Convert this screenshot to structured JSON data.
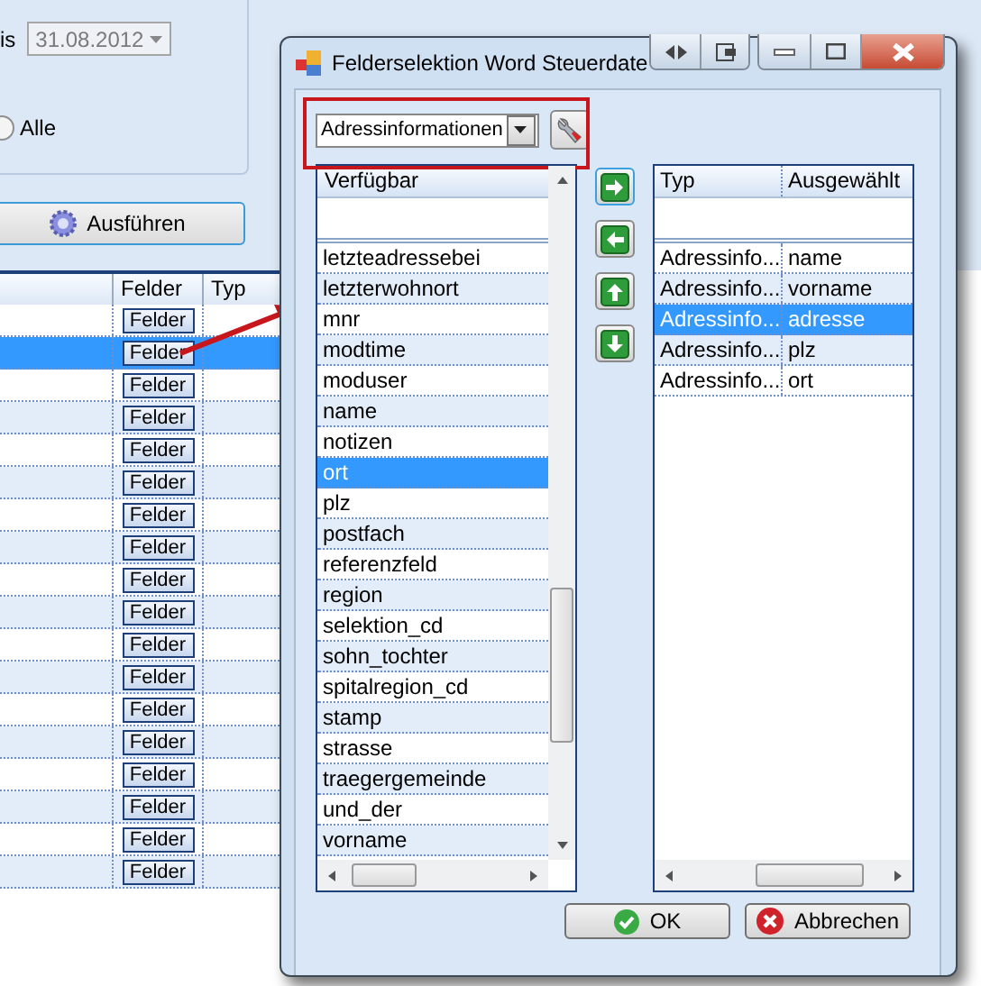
{
  "filter": {
    "date_label": "is",
    "date": "31.08.2012",
    "radio": {
      "label": "Alle",
      "selected": false
    }
  },
  "run_button": "Ausführen",
  "grid": {
    "columns": [
      "Felder",
      "Typ"
    ],
    "rows": [
      {
        "button": "Felder",
        "selected": false
      },
      {
        "button": "Felder",
        "selected": true
      },
      {
        "button": "Felder",
        "selected": false
      },
      {
        "button": "Felder",
        "selected": false
      },
      {
        "button": "Felder",
        "selected": false
      },
      {
        "button": "Felder",
        "selected": false
      },
      {
        "button": "Felder",
        "selected": false
      },
      {
        "button": "Felder",
        "selected": false
      },
      {
        "button": "Felder",
        "selected": false
      },
      {
        "button": "Felder",
        "selected": false
      },
      {
        "button": "Felder",
        "selected": false
      },
      {
        "button": "Felder",
        "selected": false
      },
      {
        "button": "Felder",
        "selected": false
      },
      {
        "button": "Felder",
        "selected": false
      },
      {
        "button": "Felder",
        "selected": false
      },
      {
        "button": "Felder",
        "selected": false
      },
      {
        "button": "Felder",
        "selected": false
      },
      {
        "button": "Felder",
        "selected": false
      }
    ]
  },
  "dialog": {
    "title": "Felderselektion Word Steuerdate",
    "category": "Adressinformationen",
    "available": {
      "header": "Verfügbar",
      "items": [
        {
          "label": "letzteadressebei",
          "selected": false
        },
        {
          "label": "letzterwohnort",
          "selected": false
        },
        {
          "label": "mnr",
          "selected": false
        },
        {
          "label": "modtime",
          "selected": false
        },
        {
          "label": "moduser",
          "selected": false
        },
        {
          "label": "name",
          "selected": false
        },
        {
          "label": "notizen",
          "selected": false
        },
        {
          "label": "ort",
          "selected": true
        },
        {
          "label": "plz",
          "selected": false
        },
        {
          "label": "postfach",
          "selected": false
        },
        {
          "label": "referenzfeld",
          "selected": false
        },
        {
          "label": "region",
          "selected": false
        },
        {
          "label": "selektion_cd",
          "selected": false
        },
        {
          "label": "sohn_tochter",
          "selected": false
        },
        {
          "label": "spitalregion_cd",
          "selected": false
        },
        {
          "label": "stamp",
          "selected": false
        },
        {
          "label": "strasse",
          "selected": false
        },
        {
          "label": "traegergemeinde",
          "selected": false
        },
        {
          "label": "und_der",
          "selected": false
        },
        {
          "label": "vorname",
          "selected": false
        }
      ]
    },
    "move_buttons": [
      {
        "kind": "right"
      },
      {
        "kind": "left"
      },
      {
        "kind": "up"
      },
      {
        "kind": "down"
      }
    ],
    "chosen": {
      "columns": [
        "Typ",
        "Ausgewählt"
      ],
      "rows": [
        {
          "type": "Adressinfo...",
          "field": "name",
          "selected": false
        },
        {
          "type": "Adressinfo...",
          "field": "vorname",
          "selected": false
        },
        {
          "type": "Adressinfo...",
          "field": "adresse",
          "selected": true
        },
        {
          "type": "Adressinfo...",
          "field": "plz",
          "selected": false
        },
        {
          "type": "Adressinfo...",
          "field": "ort",
          "selected": false
        }
      ]
    },
    "buttons": [
      {
        "label": "OK",
        "kind": "ok"
      },
      {
        "label": "Abbrechen",
        "kind": "cancel"
      }
    ]
  }
}
